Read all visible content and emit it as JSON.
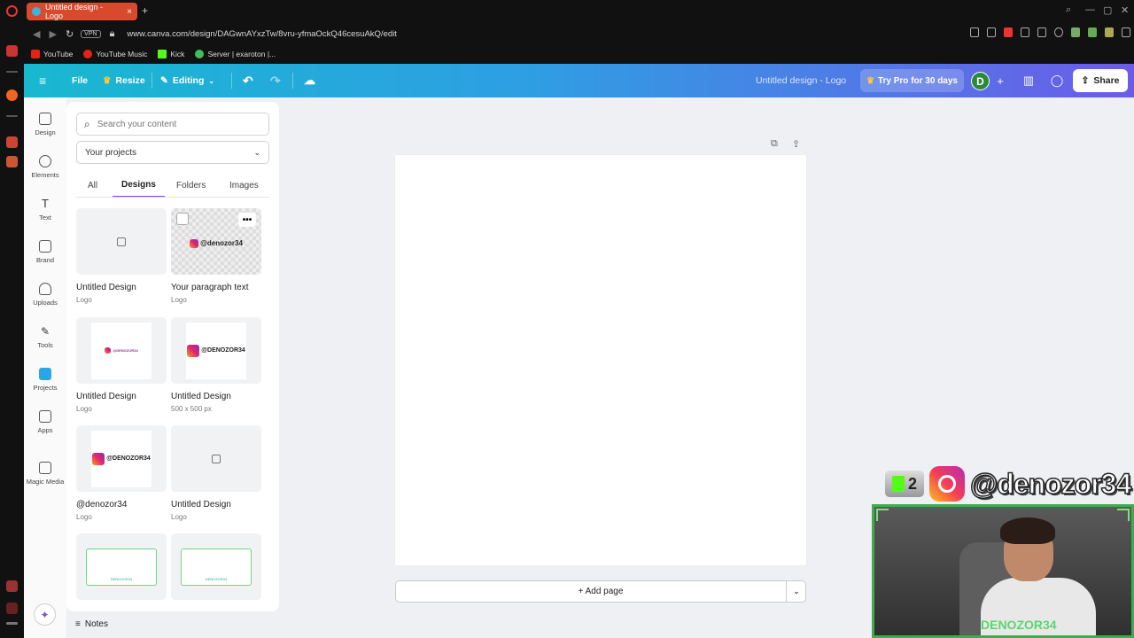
{
  "browser": {
    "tab_title": "Untitled design - Logo",
    "new_tab": "+",
    "vpn": "VPN",
    "url": "www.canva.com/design/DAGwnAYxzTw/8vru-yfmaOckQ46cesuAkQ/edit",
    "bookmarks": [
      {
        "label": "YouTube",
        "color": "#e62117"
      },
      {
        "label": "YouTube Music",
        "color": "#e62117"
      },
      {
        "label": "Kick",
        "color": "#53fc18"
      },
      {
        "label": "Server | exaroton |...",
        "color": "#3fbf5c"
      }
    ]
  },
  "header": {
    "menu_icon": "hamburger-icon",
    "file": "File",
    "resize": "Resize",
    "editing": "Editing",
    "design_title": "Untitled design - Logo",
    "try_pro": "Try Pro for 30 days",
    "avatar_initial": "D",
    "share": "Share"
  },
  "rail": [
    {
      "label": "Design",
      "icon": "layout-icon"
    },
    {
      "label": "Elements",
      "icon": "shapes-icon"
    },
    {
      "label": "Text",
      "icon": "text-icon"
    },
    {
      "label": "Brand",
      "icon": "brand-icon"
    },
    {
      "label": "Uploads",
      "icon": "upload-cloud-icon"
    },
    {
      "label": "Tools",
      "icon": "pen-icon"
    },
    {
      "label": "Projects",
      "icon": "folder-icon"
    },
    {
      "label": "Apps",
      "icon": "apps-icon"
    },
    {
      "label": "Magic Media",
      "icon": "magic-image-icon"
    }
  ],
  "panel": {
    "search_placeholder": "Search your content",
    "select_value": "Your projects",
    "tabs": [
      "All",
      "Designs",
      "Folders",
      "Images"
    ],
    "active_tab": "Designs",
    "cards": [
      {
        "title": "Untitled Design",
        "sub": "Logo"
      },
      {
        "title": "Your paragraph text",
        "sub": "Logo",
        "thumb_text": "@denozor34"
      },
      {
        "title": "Untitled Design",
        "sub": "Logo",
        "thumb_text": "@DENOZOR34"
      },
      {
        "title": "Untitled Design",
        "sub": "500 x 500 px",
        "thumb_text": "@DENOZOR34"
      },
      {
        "title": "@denozor34",
        "sub": "Logo",
        "thumb_text": "@DENOZOR34"
      },
      {
        "title": "Untitled Design",
        "sub": "Logo"
      },
      {
        "thumb_text": "DENOZOR34"
      },
      {
        "thumb_text": "DENOZOR34"
      }
    ],
    "more_label": "•••"
  },
  "canvas": {
    "add_page": "+ Add page"
  },
  "footer": {
    "notes": "Notes"
  },
  "overlay": {
    "kick_count": "2",
    "handle": "@denozor34",
    "webcam_watermark": "DENOZOR34"
  }
}
